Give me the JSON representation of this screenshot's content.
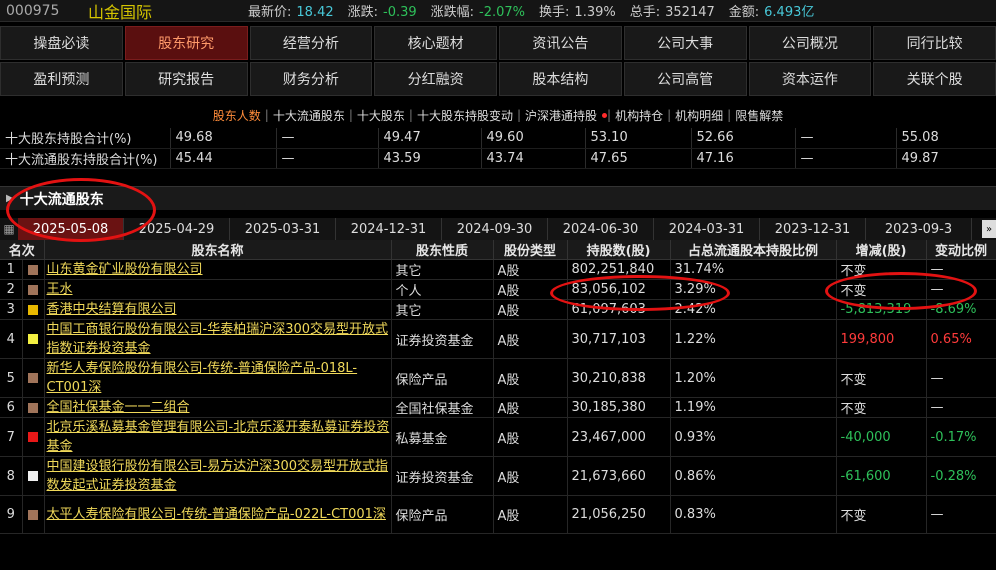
{
  "topbar": {
    "code": "000975",
    "name": "山金国际",
    "stats": [
      {
        "label": "最新价:",
        "value": "18.42",
        "color": "#48c8d8"
      },
      {
        "label": "涨跌:",
        "value": "-0.39",
        "color": "#2ec05a"
      },
      {
        "label": "涨跌幅:",
        "value": "-2.07%",
        "color": "#2ec05a"
      },
      {
        "label": "换手:",
        "value": "1.39%",
        "color": "#cccccc"
      },
      {
        "label": "总手:",
        "value": "352147",
        "color": "#cccccc"
      },
      {
        "label": "金额:",
        "value": "6.493亿",
        "color": "#48c8d8"
      }
    ]
  },
  "nav": {
    "row1": [
      "操盘必读",
      "股东研究",
      "经营分析",
      "核心题材",
      "资讯公告",
      "公司大事",
      "公司概况",
      "同行比较"
    ],
    "row2": [
      "盈利预测",
      "研究报告",
      "财务分析",
      "分红融资",
      "股本结构",
      "公司高管",
      "资本运作",
      "关联个股"
    ],
    "active": "股东研究"
  },
  "subnav": {
    "items": [
      "股东人数",
      "十大流通股东",
      "十大股东",
      "十大股东持股变动",
      "沪深港通持股",
      "机构持仓",
      "机构明细",
      "限售解禁"
    ],
    "active": "股东人数"
  },
  "summary": {
    "rows": [
      {
        "label": "十大股东持股合计(%)",
        "values": [
          "49.68",
          "—",
          "49.47",
          "49.60",
          "53.10",
          "52.66",
          "—",
          "55.08"
        ]
      },
      {
        "label": "十大流通股东持股合计(%)",
        "values": [
          "45.44",
          "—",
          "43.59",
          "43.74",
          "47.65",
          "47.16",
          "—",
          "49.87"
        ]
      }
    ]
  },
  "section": {
    "title": "十大流通股东"
  },
  "dates": {
    "tabs": [
      "2025-05-08",
      "2025-04-29",
      "2025-03-31",
      "2024-12-31",
      "2024-09-30",
      "2024-06-30",
      "2024-03-31",
      "2023-12-31",
      "2023-09-3"
    ],
    "active": "2025-05-08",
    "more": "»"
  },
  "table": {
    "headers": [
      "名次",
      "股东名称",
      "股东性质",
      "股份类型",
      "持股数(股)",
      "占总流通股本持股比例",
      "增减(股)",
      "变动比例"
    ],
    "rows": [
      {
        "rank": "1",
        "color": "#a0745a",
        "name": "山东黄金矿业股份有限公司",
        "nature": "其它",
        "type": "A股",
        "shares": "802,251,840",
        "ratio": "31.74%",
        "change": "不变",
        "changeColor": "#dddddd",
        "pct": "—",
        "pctColor": "#dddddd"
      },
      {
        "rank": "2",
        "color": "#a0745a",
        "name": "王水",
        "nature": "个人",
        "type": "A股",
        "shares": "83,056,102",
        "ratio": "3.29%",
        "change": "不变",
        "changeColor": "#dddddd",
        "pct": "—",
        "pctColor": "#dddddd"
      },
      {
        "rank": "3",
        "color": "#e8b800",
        "name": "香港中央结算有限公司",
        "nature": "其它",
        "type": "A股",
        "shares": "61,097,603",
        "ratio": "2.42%",
        "change": "-5,813,319",
        "changeColor": "#2ec05a",
        "pct": "-8.69%",
        "pctColor": "#2ec05a"
      },
      {
        "rank": "4",
        "color": "#f3f042",
        "name": "中国工商银行股份有限公司-华泰柏瑞沪深300交易型开放式指数证券投资基金",
        "nature": "证券投资基金",
        "type": "A股",
        "shares": "30,717,103",
        "ratio": "1.22%",
        "change": "199,800",
        "changeColor": "#ff3b3b",
        "pct": "0.65%",
        "pctColor": "#ff3b3b"
      },
      {
        "rank": "5",
        "color": "#a0745a",
        "name": "新华人寿保险股份有限公司-传统-普通保险产品-018L-CT001深",
        "nature": "保险产品",
        "type": "A股",
        "shares": "30,210,838",
        "ratio": "1.20%",
        "change": "不变",
        "changeColor": "#dddddd",
        "pct": "—",
        "pctColor": "#dddddd"
      },
      {
        "rank": "6",
        "color": "#a0745a",
        "name": "全国社保基金一一二组合",
        "nature": "全国社保基金",
        "type": "A股",
        "shares": "30,185,380",
        "ratio": "1.19%",
        "change": "不变",
        "changeColor": "#dddddd",
        "pct": "—",
        "pctColor": "#dddddd"
      },
      {
        "rank": "7",
        "color": "#e81818",
        "name": "北京乐溪私募基金管理有限公司-北京乐溪开泰私募证券投资基金",
        "nature": "私募基金",
        "type": "A股",
        "shares": "23,467,000",
        "ratio": "0.93%",
        "change": "-40,000",
        "changeColor": "#2ec05a",
        "pct": "-0.17%",
        "pctColor": "#2ec05a"
      },
      {
        "rank": "8",
        "color": "#f0f0f0",
        "name": "中国建设银行股份有限公司-易方达沪深300交易型开放式指数发起式证券投资基金",
        "nature": "证券投资基金",
        "type": "A股",
        "shares": "21,673,660",
        "ratio": "0.86%",
        "change": "-61,600",
        "changeColor": "#2ec05a",
        "pct": "-0.28%",
        "pctColor": "#2ec05a"
      },
      {
        "rank": "9",
        "color": "#a0745a",
        "name": "太平人寿保险有限公司-传统-普通保险产品-022L-CT001深",
        "nature": "保险产品",
        "type": "A股",
        "shares": "21,056,250",
        "ratio": "0.83%",
        "change": "不变",
        "changeColor": "#dddddd",
        "pct": "—",
        "pctColor": "#dddddd"
      }
    ]
  }
}
